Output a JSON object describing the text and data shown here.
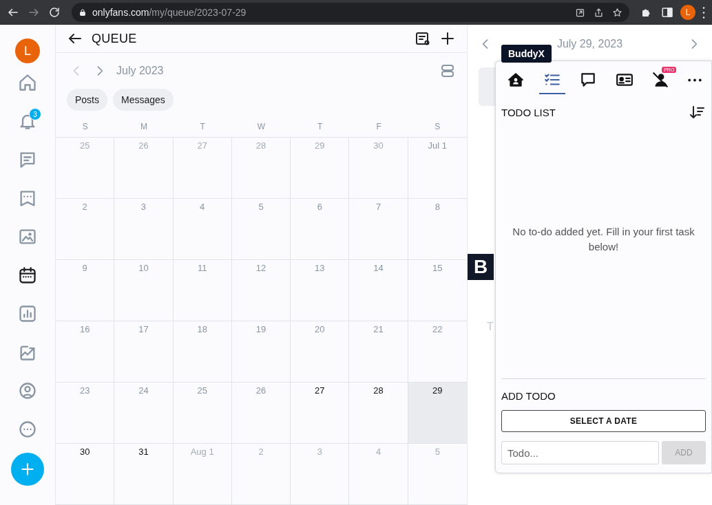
{
  "browser": {
    "back_disabled": false,
    "forward_disabled": true,
    "url": {
      "host": "onlyfans.com",
      "path": "/my/queue/2023-07-29"
    },
    "profile_initial": "L"
  },
  "sidebar": {
    "avatar_initial": "L",
    "items": [
      {
        "selected": false
      },
      {
        "selected": false,
        "badge": "3"
      },
      {
        "selected": false
      },
      {
        "selected": false
      },
      {
        "selected": false
      },
      {
        "selected": true
      },
      {
        "selected": false
      },
      {
        "selected": false
      },
      {
        "selected": false
      },
      {
        "selected": false
      }
    ]
  },
  "queue": {
    "title": "QUEUE",
    "month": "July 2023",
    "prev_disabled": true,
    "filters": [
      {
        "label": "Posts",
        "selected": false
      },
      {
        "label": "Messages",
        "selected": false
      }
    ],
    "weekdays": [
      "S",
      "M",
      "T",
      "W",
      "T",
      "F",
      "S"
    ],
    "weeks": [
      [
        {
          "day": "25",
          "other_month": true,
          "upcoming": false,
          "selected": false
        },
        {
          "day": "26",
          "other_month": true,
          "upcoming": false,
          "selected": false
        },
        {
          "day": "27",
          "other_month": true,
          "upcoming": false,
          "selected": false
        },
        {
          "day": "28",
          "other_month": true,
          "upcoming": false,
          "selected": false
        },
        {
          "day": "29",
          "other_month": true,
          "upcoming": false,
          "selected": false
        },
        {
          "day": "30",
          "other_month": true,
          "upcoming": false,
          "selected": false
        },
        {
          "day": "Jul 1",
          "other_month": false,
          "upcoming": false,
          "selected": false
        }
      ],
      [
        {
          "day": "2",
          "other_month": false,
          "upcoming": false,
          "selected": false
        },
        {
          "day": "3",
          "other_month": false,
          "upcoming": false,
          "selected": false
        },
        {
          "day": "4",
          "other_month": false,
          "upcoming": false,
          "selected": false
        },
        {
          "day": "5",
          "other_month": false,
          "upcoming": false,
          "selected": false
        },
        {
          "day": "6",
          "other_month": false,
          "upcoming": false,
          "selected": false
        },
        {
          "day": "7",
          "other_month": false,
          "upcoming": false,
          "selected": false
        },
        {
          "day": "8",
          "other_month": false,
          "upcoming": false,
          "selected": false
        }
      ],
      [
        {
          "day": "9",
          "other_month": false,
          "upcoming": false,
          "selected": false
        },
        {
          "day": "10",
          "other_month": false,
          "upcoming": false,
          "selected": false
        },
        {
          "day": "11",
          "other_month": false,
          "upcoming": false,
          "selected": false
        },
        {
          "day": "12",
          "other_month": false,
          "upcoming": false,
          "selected": false
        },
        {
          "day": "13",
          "other_month": false,
          "upcoming": false,
          "selected": false
        },
        {
          "day": "14",
          "other_month": false,
          "upcoming": false,
          "selected": false
        },
        {
          "day": "15",
          "other_month": false,
          "upcoming": false,
          "selected": false
        }
      ],
      [
        {
          "day": "16",
          "other_month": false,
          "upcoming": false,
          "selected": false
        },
        {
          "day": "17",
          "other_month": false,
          "upcoming": false,
          "selected": false
        },
        {
          "day": "18",
          "other_month": false,
          "upcoming": false,
          "selected": false
        },
        {
          "day": "19",
          "other_month": false,
          "upcoming": false,
          "selected": false
        },
        {
          "day": "20",
          "other_month": false,
          "upcoming": false,
          "selected": false
        },
        {
          "day": "21",
          "other_month": false,
          "upcoming": false,
          "selected": false
        },
        {
          "day": "22",
          "other_month": false,
          "upcoming": false,
          "selected": false
        }
      ],
      [
        {
          "day": "23",
          "other_month": false,
          "upcoming": false,
          "selected": false
        },
        {
          "day": "24",
          "other_month": false,
          "upcoming": false,
          "selected": false
        },
        {
          "day": "25",
          "other_month": false,
          "upcoming": false,
          "selected": false
        },
        {
          "day": "26",
          "other_month": false,
          "upcoming": false,
          "selected": false
        },
        {
          "day": "27",
          "other_month": false,
          "upcoming": true,
          "selected": false
        },
        {
          "day": "28",
          "other_month": false,
          "upcoming": true,
          "selected": false
        },
        {
          "day": "29",
          "other_month": false,
          "upcoming": true,
          "selected": true
        }
      ],
      [
        {
          "day": "30",
          "other_month": false,
          "upcoming": true,
          "selected": false
        },
        {
          "day": "31",
          "other_month": false,
          "upcoming": true,
          "selected": false
        },
        {
          "day": "Aug 1",
          "other_month": true,
          "upcoming": false,
          "selected": false
        },
        {
          "day": "2",
          "other_month": true,
          "upcoming": false,
          "selected": false
        },
        {
          "day": "3",
          "other_month": true,
          "upcoming": false,
          "selected": false
        },
        {
          "day": "4",
          "other_month": true,
          "upcoming": false,
          "selected": false
        },
        {
          "day": "5",
          "other_month": true,
          "upcoming": false,
          "selected": false
        }
      ]
    ]
  },
  "day_panel": {
    "date": "July 29, 2023",
    "partial_text": "T"
  },
  "buddyx": {
    "launcher": "B",
    "tooltip": "BuddyX",
    "tabs": [
      {
        "selected": false
      },
      {
        "selected": true
      },
      {
        "selected": false
      },
      {
        "selected": false
      },
      {
        "selected": false,
        "badge": "PRO"
      },
      {
        "selected": false
      }
    ],
    "heading": "TODO LIST",
    "empty_message": "No to-do added yet. Fill in your first task below!",
    "add_heading": "ADD TODO",
    "date_button": "SELECT A DATE",
    "todo_placeholder": "Todo...",
    "add_button": {
      "label": "ADD",
      "disabled": true
    }
  }
}
